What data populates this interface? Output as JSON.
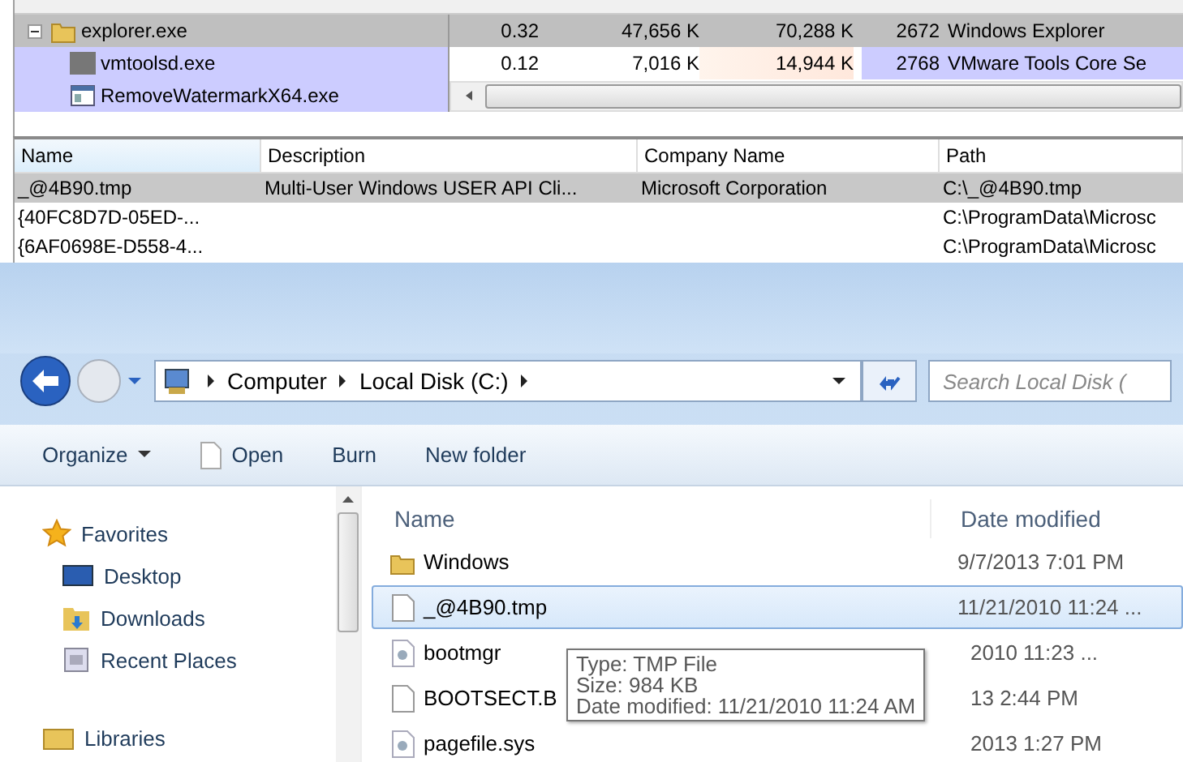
{
  "process_tree": {
    "rows": [
      {
        "name": "explorer.exe",
        "kind": "folder",
        "expanded": true,
        "selected": true,
        "cells": [
          "0.32",
          "47,656 K",
          "70,288 K",
          "2672",
          "Windows Explorer"
        ],
        "children": [
          {
            "name": "vmtoolsd.exe",
            "kind": "vm",
            "selected": false,
            "color": "#ccccff",
            "cells": [
              "0.12",
              "7,016 K",
              "14,944 K",
              "2768",
              "VMware Tools Core Se"
            ]
          },
          {
            "name": "RemoveWatermarkX64.exe",
            "kind": "app",
            "selected": false,
            "color": "#ccccff"
          }
        ]
      }
    ]
  },
  "dll_list": {
    "columns": [
      {
        "label": "Name",
        "sorted": true
      },
      {
        "label": "Description",
        "sorted": false
      },
      {
        "label": "Company Name",
        "sorted": false
      },
      {
        "label": "Path",
        "sorted": false
      }
    ],
    "rows": [
      {
        "selected": true,
        "cells": [
          "_@4B90.tmp",
          "Multi-User Windows USER API Cli...",
          "Microsoft Corporation",
          "C:\\_@4B90.tmp"
        ]
      },
      {
        "selected": false,
        "cells": [
          "{40FC8D7D-05ED-...",
          "",
          "",
          "C:\\ProgramData\\Microsc"
        ]
      },
      {
        "selected": false,
        "cells": [
          "{6AF0698E-D558-4...",
          "",
          "",
          "C:\\ProgramData\\Microsc"
        ]
      }
    ]
  },
  "explorer": {
    "breadcrumb": [
      "Computer",
      "Local Disk (C:)"
    ],
    "search": {
      "placeholder": "Search Local Disk ("
    },
    "toolbar": [
      {
        "kind": "menu",
        "label": "Organize"
      },
      {
        "kind": "file",
        "label": "Open"
      },
      {
        "kind": "plain",
        "label": "Burn"
      },
      {
        "kind": "plain",
        "label": "New folder"
      }
    ],
    "sidebar": [
      {
        "kind": "favorites",
        "label": "Favorites"
      },
      {
        "kind": "desktop",
        "label": "Desktop"
      },
      {
        "kind": "downloads",
        "label": "Downloads"
      },
      {
        "kind": "recent",
        "label": "Recent Places"
      },
      {
        "kind": "libraries",
        "label": "Libraries"
      }
    ],
    "columns": [
      "Name",
      "Date modified"
    ],
    "files": [
      {
        "kind": "folder",
        "name": "Windows",
        "date": "9/7/2013 7:01 PM",
        "selected": false
      },
      {
        "kind": "file",
        "name": "_@4B90.tmp",
        "date": "11/21/2010 11:24 ...",
        "selected": true
      },
      {
        "kind": "system",
        "name": "bootmgr",
        "date": "2010 11:23 ...",
        "selected": false
      },
      {
        "kind": "file",
        "name": "BOOTSECT.B",
        "date": "13 2:44 PM",
        "selected": false
      },
      {
        "kind": "system",
        "name": "pagefile.sys",
        "date": "2013 1:27 PM",
        "selected": false
      }
    ],
    "tooltip": [
      "Type: TMP File",
      "Size: 984 KB",
      "Date modified: 11/21/2010 11:24 AM"
    ]
  }
}
